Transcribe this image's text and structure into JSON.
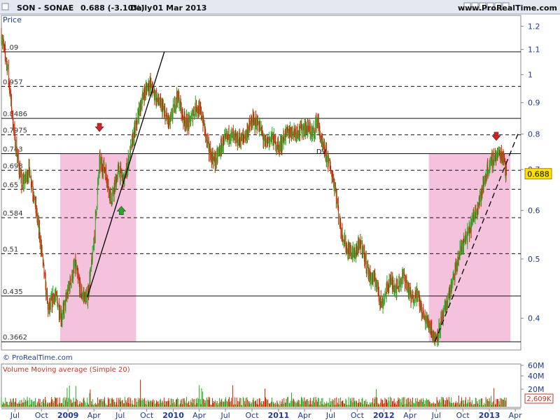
{
  "header": {
    "ticker": "SON - SONAE",
    "quote": "0.688 (-3.10%)",
    "period": "Daily",
    "date": "01 Mar 2013",
    "site": "www.ProRealTime.com"
  },
  "price_panel": {
    "label": "Price",
    "current_label": "0.688",
    "watermark": "© ProRealTime.com"
  },
  "volume_panel": {
    "label": "Volume Moving average (Simple 20)",
    "current_label": "2,609K"
  },
  "colors": {
    "up": "#22aa22",
    "down": "#cc2200",
    "zone": "#f5c2de",
    "accent": "#ffe100",
    "axis_text": "#1f3a93"
  },
  "chart_data": {
    "type": "candlestick",
    "title": "SON - SONAE",
    "yscale": "log",
    "ylim": [
      0.355,
      1.25
    ],
    "y_ticks": [
      1.2,
      1.1,
      1,
      0.9,
      0.8,
      0.7,
      0.6,
      0.5,
      0.4
    ],
    "y_tick_labels": [
      "1.2",
      "1.1",
      "1",
      "0.9",
      "0.8",
      "0.7",
      "0.6",
      "0.5",
      "0.4"
    ],
    "xlim": [
      "2008-05-15",
      "2013-04-20"
    ],
    "x_ticks": [
      {
        "date": "2008-07-01",
        "label": "Jul",
        "year": false
      },
      {
        "date": "2008-10-01",
        "label": "Oct",
        "year": false
      },
      {
        "date": "2009-01-01",
        "label": "2009",
        "year": true
      },
      {
        "date": "2009-04-01",
        "label": "Apr",
        "year": false
      },
      {
        "date": "2009-07-01",
        "label": "Jul",
        "year": false
      },
      {
        "date": "2009-10-01",
        "label": "Oct",
        "year": false
      },
      {
        "date": "2010-01-01",
        "label": "2010",
        "year": true
      },
      {
        "date": "2010-04-01",
        "label": "Apr",
        "year": false
      },
      {
        "date": "2010-07-01",
        "label": "Jul",
        "year": false
      },
      {
        "date": "2010-10-01",
        "label": "Oct",
        "year": false
      },
      {
        "date": "2011-01-01",
        "label": "2011",
        "year": true
      },
      {
        "date": "2011-04-01",
        "label": "Apr",
        "year": false
      },
      {
        "date": "2011-07-01",
        "label": "Jul",
        "year": false
      },
      {
        "date": "2011-10-01",
        "label": "Oct",
        "year": false
      },
      {
        "date": "2012-01-01",
        "label": "2012",
        "year": true
      },
      {
        "date": "2012-04-01",
        "label": "Apr",
        "year": false
      },
      {
        "date": "2012-07-01",
        "label": "Jul",
        "year": false
      },
      {
        "date": "2012-10-01",
        "label": "Oct",
        "year": false
      },
      {
        "date": "2013-01-01",
        "label": "2013",
        "year": true
      },
      {
        "date": "2013-04-01",
        "label": "Apr",
        "year": false
      }
    ],
    "price_path": [
      [
        "2008-05-15",
        1.16
      ],
      [
        "2008-06-05",
        1.03
      ],
      [
        "2008-07-01",
        0.78
      ],
      [
        "2008-07-25",
        0.66
      ],
      [
        "2008-08-20",
        0.7
      ],
      [
        "2008-09-15",
        0.59
      ],
      [
        "2008-10-05",
        0.5
      ],
      [
        "2008-10-25",
        0.41
      ],
      [
        "2008-11-15",
        0.44
      ],
      [
        "2008-12-10",
        0.4
      ],
      [
        "2009-01-05",
        0.45
      ],
      [
        "2009-01-25",
        0.49
      ],
      [
        "2009-02-15",
        0.44
      ],
      [
        "2009-03-09",
        0.43
      ],
      [
        "2009-03-30",
        0.52
      ],
      [
        "2009-04-20",
        0.72
      ],
      [
        "2009-05-10",
        0.7
      ],
      [
        "2009-06-01",
        0.62
      ],
      [
        "2009-06-25",
        0.7
      ],
      [
        "2009-07-15",
        0.67
      ],
      [
        "2009-08-05",
        0.75
      ],
      [
        "2009-08-30",
        0.85
      ],
      [
        "2009-09-20",
        0.93
      ],
      [
        "2009-10-10",
        0.97
      ],
      [
        "2009-11-01",
        0.92
      ],
      [
        "2009-11-25",
        0.88
      ],
      [
        "2009-12-20",
        0.83
      ],
      [
        "2010-01-15",
        0.93
      ],
      [
        "2010-02-05",
        0.85
      ],
      [
        "2010-02-25",
        0.83
      ],
      [
        "2010-03-20",
        0.89
      ],
      [
        "2010-04-10",
        0.86
      ],
      [
        "2010-05-05",
        0.75
      ],
      [
        "2010-05-25",
        0.72
      ],
      [
        "2010-06-20",
        0.77
      ],
      [
        "2010-07-15",
        0.8
      ],
      [
        "2010-08-10",
        0.78
      ],
      [
        "2010-09-05",
        0.79
      ],
      [
        "2010-10-01",
        0.84
      ],
      [
        "2010-10-25",
        0.83
      ],
      [
        "2010-11-15",
        0.77
      ],
      [
        "2010-12-05",
        0.79
      ],
      [
        "2011-01-05",
        0.76
      ],
      [
        "2011-01-25",
        0.8
      ],
      [
        "2011-02-20",
        0.81
      ],
      [
        "2011-03-15",
        0.81
      ],
      [
        "2011-04-10",
        0.82
      ],
      [
        "2011-05-01",
        0.8
      ],
      [
        "2011-05-15",
        0.85
      ],
      [
        "2011-05-30",
        0.77
      ],
      [
        "2011-06-20",
        0.73
      ],
      [
        "2011-07-15",
        0.66
      ],
      [
        "2011-08-05",
        0.56
      ],
      [
        "2011-08-25",
        0.52
      ],
      [
        "2011-09-20",
        0.51
      ],
      [
        "2011-10-15",
        0.53
      ],
      [
        "2011-11-10",
        0.47
      ],
      [
        "2011-12-05",
        0.46
      ],
      [
        "2011-12-25",
        0.42
      ],
      [
        "2012-01-20",
        0.46
      ],
      [
        "2012-02-15",
        0.45
      ],
      [
        "2012-03-10",
        0.47
      ],
      [
        "2012-04-05",
        0.43
      ],
      [
        "2012-04-25",
        0.44
      ],
      [
        "2012-05-20",
        0.4
      ],
      [
        "2012-06-10",
        0.39
      ],
      [
        "2012-06-26",
        0.368
      ],
      [
        "2012-07-15",
        0.39
      ],
      [
        "2012-08-05",
        0.42
      ],
      [
        "2012-09-01",
        0.47
      ],
      [
        "2012-09-25",
        0.52
      ],
      [
        "2012-10-20",
        0.55
      ],
      [
        "2012-11-15",
        0.6
      ],
      [
        "2012-12-05",
        0.64
      ],
      [
        "2012-12-25",
        0.7
      ],
      [
        "2013-01-15",
        0.73
      ],
      [
        "2013-02-05",
        0.745
      ],
      [
        "2013-02-20",
        0.735
      ],
      [
        "2013-03-01",
        0.688
      ]
    ],
    "fib_levels": [
      {
        "value": 1.09,
        "label": "1.09",
        "style": "solid"
      },
      {
        "value": 0.957,
        "label": "0.957",
        "style": "dashed"
      },
      {
        "value": 0.8486,
        "label": "0.8486",
        "style": "solid"
      },
      {
        "value": 0.7975,
        "label": "0.7975",
        "style": "dashed"
      },
      {
        "value": 0.743,
        "label": "0.743",
        "style": "solid"
      },
      {
        "value": 0.698,
        "label": "0.698",
        "style": "dashed"
      },
      {
        "value": 0.65,
        "label": "0.65",
        "style": "dashed"
      },
      {
        "value": 0.584,
        "label": "0.584",
        "style": "dashed"
      },
      {
        "value": 0.51,
        "label": "0.51",
        "style": "dashed"
      },
      {
        "value": 0.435,
        "label": "0.435",
        "style": "solid"
      },
      {
        "value": 0.3662,
        "label": "0.3662",
        "style": "solid"
      }
    ],
    "zones": [
      {
        "from": "2008-12-05",
        "to": "2009-08-25",
        "top": 0.743,
        "bottom": 0.3662
      },
      {
        "from": "2012-06-05",
        "to": "2013-03-15",
        "top": 0.743,
        "bottom": 0.3662
      }
    ],
    "trendlines": [
      {
        "from": [
          "2009-03-09",
          0.433
        ],
        "to": [
          "2009-12-01",
          1.09
        ],
        "style": "solid"
      },
      {
        "from": [
          "2012-06-26",
          0.3662
        ],
        "to": [
          "2013-04-10",
          0.8
        ],
        "style": "dashed"
      }
    ],
    "signals": [
      {
        "date": "2009-04-20",
        "price": 0.82,
        "direction": "down",
        "color": "#d42020"
      },
      {
        "date": "2009-07-05",
        "price": 0.6,
        "direction": "up",
        "color": "#2aa52a"
      },
      {
        "date": "2013-01-25",
        "price": 0.793,
        "direction": "down",
        "color": "#d42020"
      }
    ],
    "annotations": [
      {
        "date": "2011-05-12",
        "price": 0.742,
        "text": "DV"
      }
    ],
    "volume": {
      "label": "Volume Moving average (Simple 20)",
      "y_tick_labels": [
        "60M",
        "40M",
        "20M"
      ],
      "last_value_label": "2,609K"
    }
  }
}
